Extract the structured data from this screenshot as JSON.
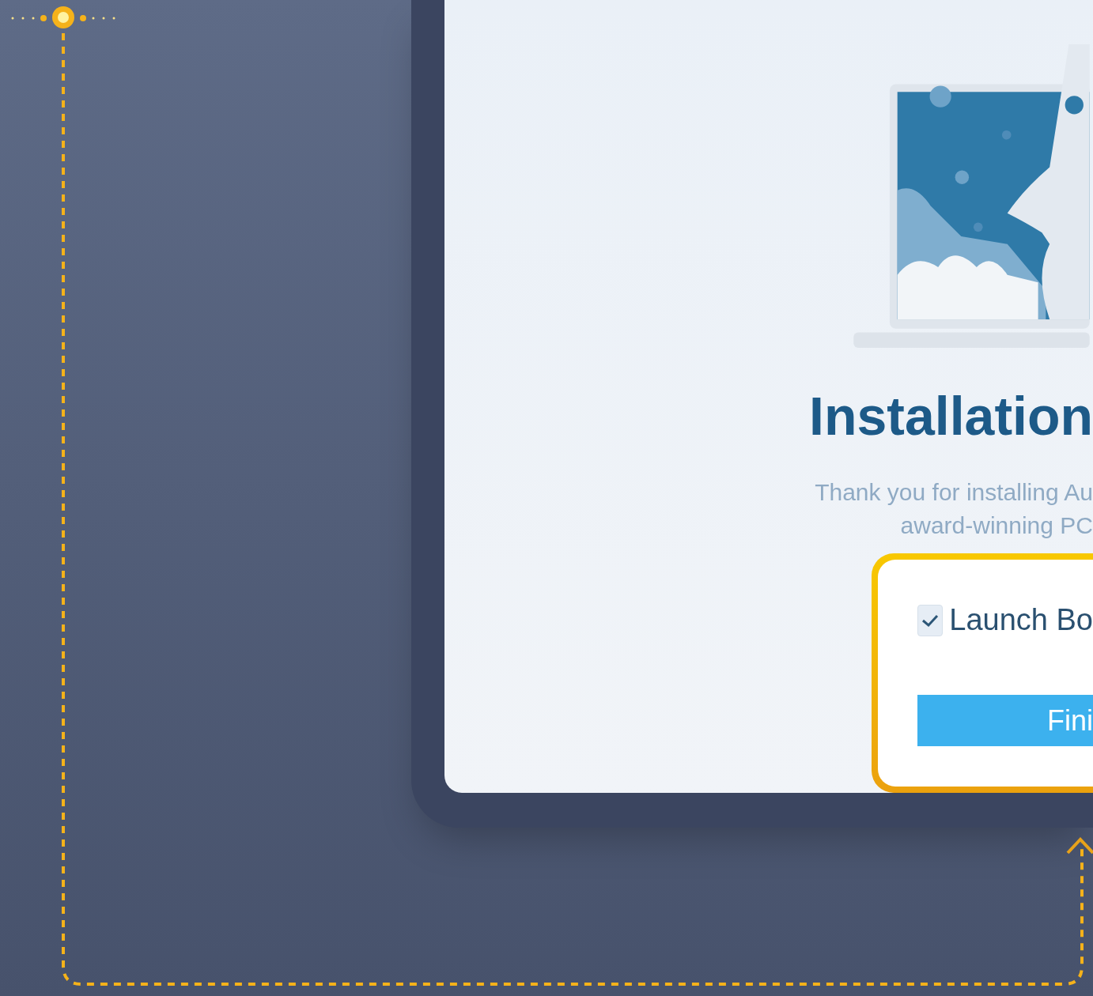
{
  "installer": {
    "title": "Installation",
    "message_lines": [
      "Thank you for installing Au",
      "award-winning PC"
    ],
    "launch_option": {
      "label": "Launch Bo",
      "checked": true
    },
    "finish_button": {
      "label": "Fini"
    }
  }
}
